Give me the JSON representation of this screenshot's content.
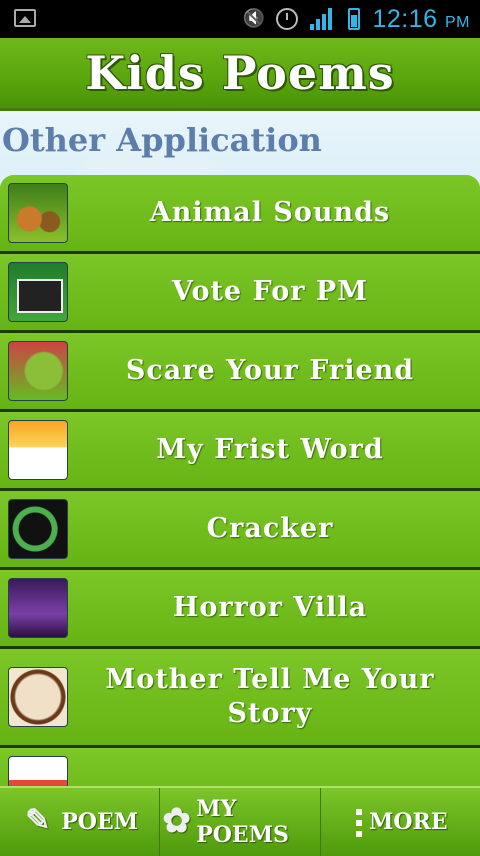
{
  "status_bar": {
    "time": "12:16",
    "ampm": "PM"
  },
  "header": {
    "title": "Kids Poems"
  },
  "section": {
    "title": "Other Application"
  },
  "apps": [
    {
      "label": "Animal Sounds",
      "icon": "animal-sounds-thumbnail"
    },
    {
      "label": "Vote For PM",
      "icon": "ballot-box-thumbnail"
    },
    {
      "label": "Scare Your Friend",
      "icon": "zombie-thumbnail"
    },
    {
      "label": "My Frist Word",
      "icon": "sunrise-thumbnail"
    },
    {
      "label": "Cracker",
      "icon": "cracker-thumbnail"
    },
    {
      "label": "Horror Villa",
      "icon": "haunted-house-thumbnail"
    },
    {
      "label": "Mother Tell Me Your Story",
      "icon": "mother-story-thumbnail"
    }
  ],
  "bottom_bar": {
    "poem": "POEM",
    "my_poems": "MY POEMS",
    "more": "MORE"
  },
  "colors": {
    "accent": "#6fb91c",
    "title_blue": "#5d7dab",
    "status_blue": "#33b5e5"
  }
}
